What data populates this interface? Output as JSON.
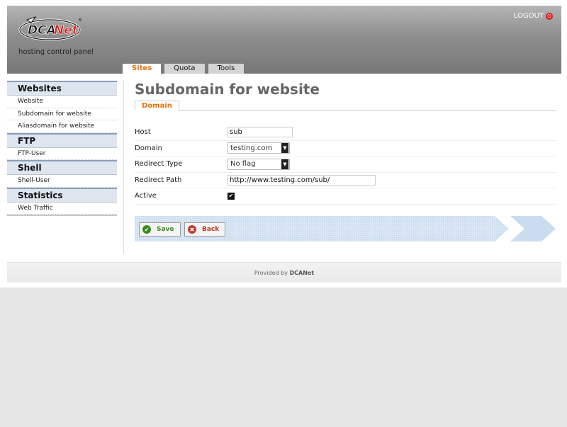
{
  "header": {
    "logo_text": "DCANet",
    "tagline": "hosting control panel",
    "logout_label": "LOGOUT"
  },
  "tabs": [
    {
      "label": "Sites",
      "active": true
    },
    {
      "label": "Quota",
      "active": false
    },
    {
      "label": "Tools",
      "active": false
    }
  ],
  "sidebar": {
    "sections": [
      {
        "title": "Websites",
        "items": [
          "Website",
          "Subdomain for website",
          "Aliasdomain for website"
        ]
      },
      {
        "title": "FTP",
        "items": [
          "FTP-User"
        ]
      },
      {
        "title": "Shell",
        "items": [
          "Shell-User"
        ]
      },
      {
        "title": "Statistics",
        "items": [
          "Web Traffic"
        ]
      }
    ]
  },
  "main": {
    "title": "Subdomain for website",
    "subtab": "Domain",
    "form": {
      "host_label": "Host",
      "host_value": "sub",
      "domain_label": "Domain",
      "domain_value": "testing.com",
      "redirect_type_label": "Redirect Type",
      "redirect_type_value": "No flag",
      "redirect_path_label": "Redirect Path",
      "redirect_path_value": "http://www.testing.com/sub/",
      "active_label": "Active",
      "active_checked": true
    },
    "buttons": {
      "save_label": "Save",
      "back_label": "Back"
    }
  },
  "footer": {
    "prefix": "Provided by",
    "brand": "DCANet"
  },
  "colors": {
    "accent_orange": "#e8720c",
    "save_green": "#3a8a1f",
    "back_red": "#c0392b",
    "sidebar_header_bg": "#dde5ee",
    "action_bar_blue": "#cfe0f1"
  }
}
